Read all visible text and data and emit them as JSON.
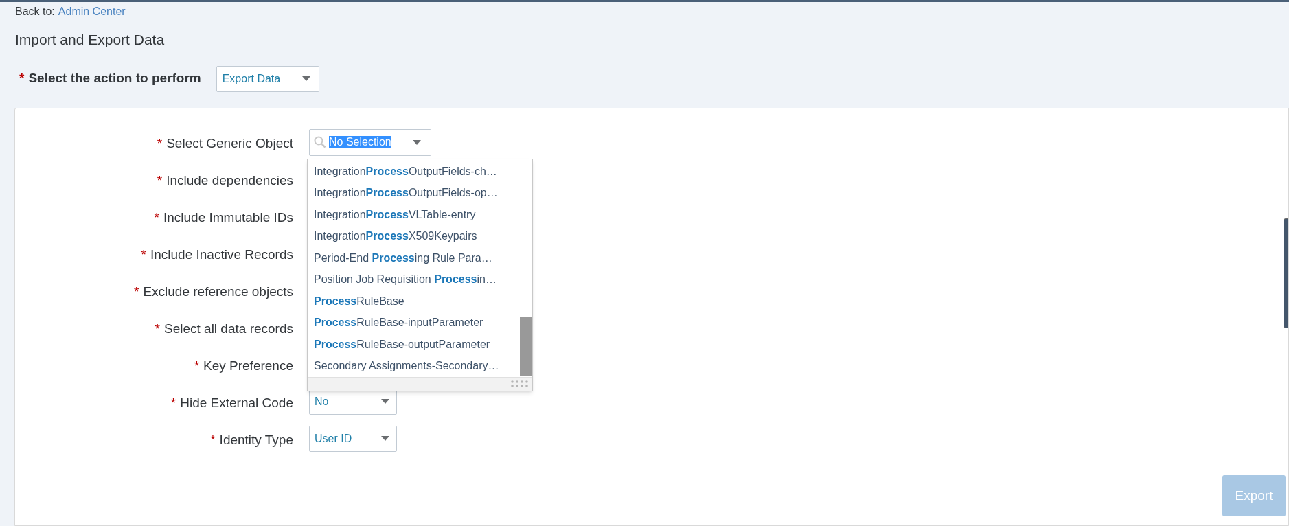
{
  "breadcrumb": {
    "prefix": "Back to:",
    "link": "Admin Center"
  },
  "title": "Import and Export Data",
  "action": {
    "required_mark": "*",
    "label": "Select the action to perform",
    "value": "Export Data"
  },
  "fields": [
    {
      "required_mark": "*",
      "label": "Select Generic Object",
      "control": {
        "kind": "combobox",
        "value": "No Selection",
        "text_selected": true
      }
    },
    {
      "required_mark": "*",
      "label": "Include dependencies"
    },
    {
      "required_mark": "*",
      "label": "Include Immutable IDs"
    },
    {
      "required_mark": "*",
      "label": "Include Inactive Records"
    },
    {
      "required_mark": "*",
      "label": "Exclude reference objects"
    },
    {
      "required_mark": "*",
      "label": "Select all data records"
    },
    {
      "required_mark": "*",
      "label": "Key Preference"
    },
    {
      "required_mark": "*",
      "label": "Hide External Code",
      "control": {
        "kind": "select",
        "value": "No"
      }
    },
    {
      "required_mark": "*",
      "label": "Identity Type",
      "control": {
        "kind": "select",
        "value": "User ID"
      }
    }
  ],
  "dropdown_list": {
    "items": [
      "Integration**Process**OutputFields-ch…",
      "Integration**Process**OutputFields-op…",
      "Integration**Process**VLTable-entry",
      "Integration**Process**X509Keypairs",
      "Period-End **Process**ing Rule Para…",
      "Position Job Requisition **Process**in…",
      "**Process**RuleBase",
      "**Process**RuleBase-inputParameter",
      "**Process**RuleBase-outputParameter",
      "Secondary Assignments-Secondary…"
    ]
  },
  "export_button": {
    "label": "Export",
    "disabled": true
  }
}
